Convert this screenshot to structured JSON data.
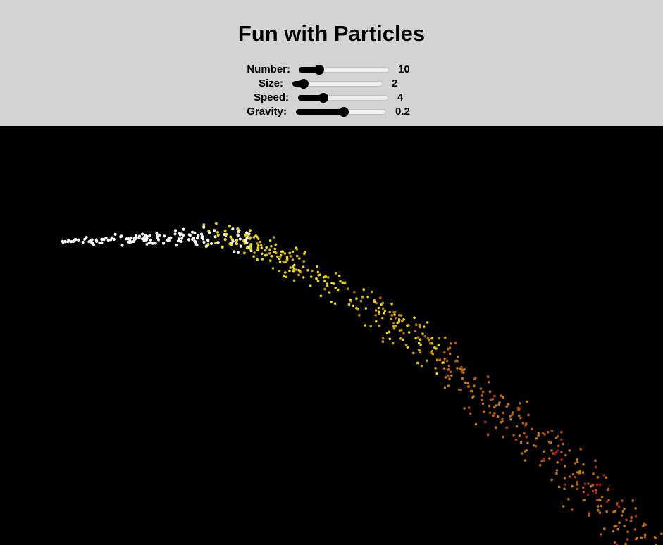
{
  "title": "Fun with Particles",
  "controls": {
    "number": {
      "label": "Number:",
      "value": "10",
      "fraction": 0.22
    },
    "size": {
      "label": "Size:",
      "value": "2",
      "fraction": 0.12
    },
    "speed": {
      "label": "Speed:",
      "value": "4",
      "fraction": 0.27
    },
    "gravity": {
      "label": "Gravity:",
      "value": "0.2",
      "fraction": 0.52
    }
  },
  "colors": {
    "header_bg": "#d3d3d3",
    "canvas_bg": "#000000",
    "slider_fill": "#000000",
    "particle_palette": [
      "#ffffff",
      "#e6d51c",
      "#c9a51a",
      "#b8741c",
      "#b8501a",
      "#a81d10"
    ]
  }
}
